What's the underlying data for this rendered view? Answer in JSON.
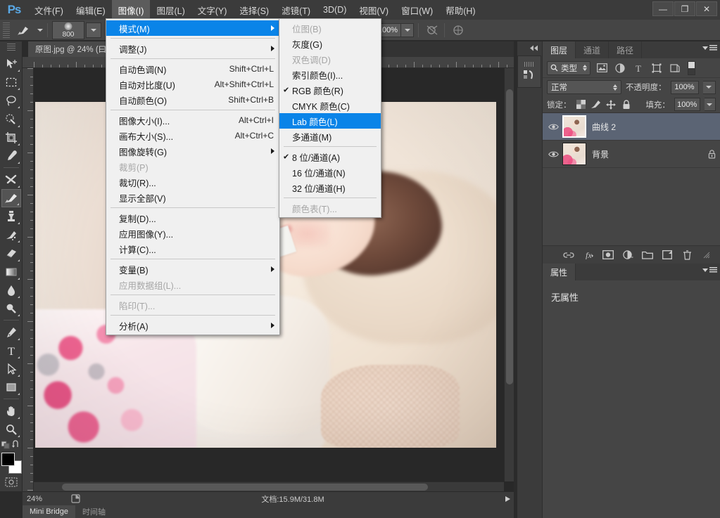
{
  "app": {
    "logo": "Ps"
  },
  "menubar": {
    "items": [
      {
        "label": "文件(F)",
        "active": false
      },
      {
        "label": "编辑(E)",
        "active": false
      },
      {
        "label": "图像(I)",
        "active": true
      },
      {
        "label": "图层(L)",
        "active": false
      },
      {
        "label": "文字(Y)",
        "active": false
      },
      {
        "label": "选择(S)",
        "active": false
      },
      {
        "label": "滤镜(T)",
        "active": false
      },
      {
        "label": "3D(D)",
        "active": false
      },
      {
        "label": "视图(V)",
        "active": false
      },
      {
        "label": "窗口(W)",
        "active": false
      },
      {
        "label": "帮助(H)",
        "active": false
      }
    ],
    "window_controls": {
      "minimize": "—",
      "restore": "❐",
      "close": "✕"
    }
  },
  "options_bar": {
    "brush_size": "800",
    "mode_label": "",
    "opacity_value": "100%",
    "airbrush_icon": "airbrush-icon",
    "symmetry_icon": "symmetry-icon"
  },
  "document_tab": {
    "title": "原图.jpg @ 24% (曰"
  },
  "toolbar": {
    "tools": [
      {
        "name": "move-tool",
        "selected": false
      },
      {
        "name": "marquee-tool",
        "selected": false
      },
      {
        "name": "lasso-tool",
        "selected": false
      },
      {
        "name": "quick-selection-tool",
        "selected": false
      },
      {
        "name": "crop-tool",
        "selected": false
      },
      {
        "name": "eyedropper-tool",
        "selected": false
      },
      {
        "name": "healing-brush-tool",
        "selected": false
      },
      {
        "name": "brush-tool",
        "selected": true
      },
      {
        "name": "clone-stamp-tool",
        "selected": false
      },
      {
        "name": "history-brush-tool",
        "selected": false
      },
      {
        "name": "eraser-tool",
        "selected": false
      },
      {
        "name": "gradient-tool",
        "selected": false
      },
      {
        "name": "blur-tool",
        "selected": false
      },
      {
        "name": "dodge-tool",
        "selected": false
      },
      {
        "name": "pen-tool",
        "selected": false
      },
      {
        "name": "type-tool",
        "selected": false
      },
      {
        "name": "path-selection-tool",
        "selected": false
      },
      {
        "name": "rectangle-tool",
        "selected": false
      },
      {
        "name": "hand-tool",
        "selected": false
      },
      {
        "name": "zoom-tool",
        "selected": false
      }
    ],
    "foreground_color": "#000000",
    "background_color": "#ffffff"
  },
  "image_menu": {
    "title": "图像(I)",
    "items": [
      {
        "label": "模式(M)",
        "shortcut": "",
        "submenu": true,
        "highlight": true,
        "disabled": false,
        "sep_after": true
      },
      {
        "label": "调整(J)",
        "shortcut": "",
        "submenu": true,
        "highlight": false,
        "disabled": false,
        "sep_after": true
      },
      {
        "label": "自动色调(N)",
        "shortcut": "Shift+Ctrl+L",
        "submenu": false,
        "highlight": false,
        "disabled": false,
        "sep_after": false
      },
      {
        "label": "自动对比度(U)",
        "shortcut": "Alt+Shift+Ctrl+L",
        "submenu": false,
        "highlight": false,
        "disabled": false,
        "sep_after": false
      },
      {
        "label": "自动颜色(O)",
        "shortcut": "Shift+Ctrl+B",
        "submenu": false,
        "highlight": false,
        "disabled": false,
        "sep_after": true
      },
      {
        "label": "图像大小(I)...",
        "shortcut": "Alt+Ctrl+I",
        "submenu": false,
        "highlight": false,
        "disabled": false,
        "sep_after": false
      },
      {
        "label": "画布大小(S)...",
        "shortcut": "Alt+Ctrl+C",
        "submenu": false,
        "highlight": false,
        "disabled": false,
        "sep_after": false
      },
      {
        "label": "图像旋转(G)",
        "shortcut": "",
        "submenu": true,
        "highlight": false,
        "disabled": false,
        "sep_after": false
      },
      {
        "label": "裁剪(P)",
        "shortcut": "",
        "submenu": false,
        "highlight": false,
        "disabled": true,
        "sep_after": false
      },
      {
        "label": "裁切(R)...",
        "shortcut": "",
        "submenu": false,
        "highlight": false,
        "disabled": false,
        "sep_after": false
      },
      {
        "label": "显示全部(V)",
        "shortcut": "",
        "submenu": false,
        "highlight": false,
        "disabled": false,
        "sep_after": true
      },
      {
        "label": "复制(D)...",
        "shortcut": "",
        "submenu": false,
        "highlight": false,
        "disabled": false,
        "sep_after": false
      },
      {
        "label": "应用图像(Y)...",
        "shortcut": "",
        "submenu": false,
        "highlight": false,
        "disabled": false,
        "sep_after": false
      },
      {
        "label": "计算(C)...",
        "shortcut": "",
        "submenu": false,
        "highlight": false,
        "disabled": false,
        "sep_after": true
      },
      {
        "label": "变量(B)",
        "shortcut": "",
        "submenu": true,
        "highlight": false,
        "disabled": false,
        "sep_after": false
      },
      {
        "label": "应用数据组(L)...",
        "shortcut": "",
        "submenu": false,
        "highlight": false,
        "disabled": true,
        "sep_after": true
      },
      {
        "label": "陷印(T)...",
        "shortcut": "",
        "submenu": false,
        "highlight": false,
        "disabled": true,
        "sep_after": true
      },
      {
        "label": "分析(A)",
        "shortcut": "",
        "submenu": true,
        "highlight": false,
        "disabled": false,
        "sep_after": false
      }
    ]
  },
  "mode_submenu": {
    "items": [
      {
        "label": "位图(B)",
        "checked": false,
        "disabled": true,
        "sep_after": false,
        "highlight": false
      },
      {
        "label": "灰度(G)",
        "checked": false,
        "disabled": false,
        "sep_after": false,
        "highlight": false
      },
      {
        "label": "双色调(D)",
        "checked": false,
        "disabled": true,
        "sep_after": false,
        "highlight": false
      },
      {
        "label": "索引颜色(I)...",
        "checked": false,
        "disabled": false,
        "sep_after": false,
        "highlight": false
      },
      {
        "label": "RGB 颜色(R)",
        "checked": true,
        "disabled": false,
        "sep_after": false,
        "highlight": false
      },
      {
        "label": "CMYK 颜色(C)",
        "checked": false,
        "disabled": false,
        "sep_after": false,
        "highlight": false
      },
      {
        "label": "Lab 颜色(L)",
        "checked": false,
        "disabled": false,
        "sep_after": false,
        "highlight": true
      },
      {
        "label": "多通道(M)",
        "checked": false,
        "disabled": false,
        "sep_after": true,
        "highlight": false
      },
      {
        "label": "8 位/通道(A)",
        "checked": true,
        "disabled": false,
        "sep_after": false,
        "highlight": false
      },
      {
        "label": "16 位/通道(N)",
        "checked": false,
        "disabled": false,
        "sep_after": false,
        "highlight": false
      },
      {
        "label": "32 位/通道(H)",
        "checked": false,
        "disabled": false,
        "sep_after": true,
        "highlight": false
      },
      {
        "label": "颜色表(T)...",
        "checked": false,
        "disabled": true,
        "sep_after": false,
        "highlight": false
      }
    ]
  },
  "layers_panel": {
    "tabs": [
      {
        "label": "图层",
        "active": true
      },
      {
        "label": "通道",
        "active": false
      },
      {
        "label": "路径",
        "active": false
      }
    ],
    "filter": {
      "kind_label": "类型",
      "icons": [
        "pixel-filter-icon",
        "adjustment-filter-icon",
        "type-filter-icon",
        "shape-filter-icon",
        "smart-object-filter-icon"
      ]
    },
    "blend_mode": "正常",
    "opacity_label": "不透明度：",
    "opacity_value": "100%",
    "lock_label": "锁定：",
    "fill_label": "填充：",
    "fill_value": "100%",
    "layers": [
      {
        "name": "曲线 2",
        "visible": true,
        "selected": true,
        "locked": false
      },
      {
        "name": "背景",
        "visible": true,
        "selected": false,
        "locked": true
      }
    ],
    "bottom_buttons": [
      "link-layers-icon",
      "layer-styles-icon",
      "layer-mask-icon",
      "adjustment-layer-icon",
      "new-group-icon",
      "new-layer-icon",
      "delete-layer-icon"
    ]
  },
  "properties_panel": {
    "tab_label": "属性",
    "empty_text": "无属性"
  },
  "status_bar": {
    "zoom": "24%",
    "doc_info": "文档:15.9M/31.8M"
  },
  "bottom_dock": {
    "tabs": [
      {
        "label": "Mini Bridge",
        "active": true
      },
      {
        "label": "时间轴",
        "active": false
      }
    ]
  },
  "colors": {
    "accent_highlight": "#0a84e8",
    "panel_bg": "#454545",
    "chrome_bg": "#3b3b3b",
    "canvas_bg": "#282828",
    "selected_layer": "#5b6474"
  }
}
